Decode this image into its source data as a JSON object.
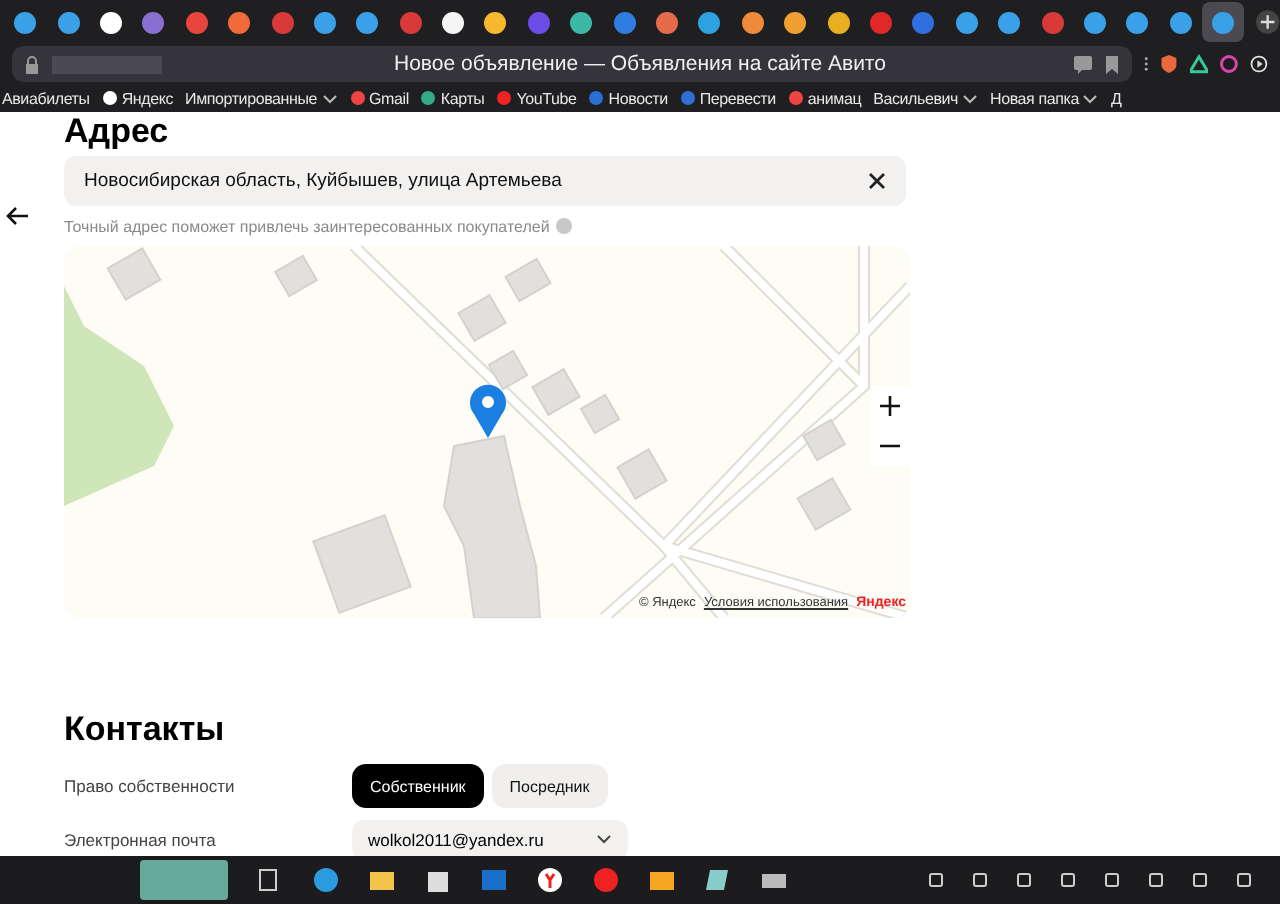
{
  "browser": {
    "tabs": [
      {
        "color": "#3aa0e8",
        "selected": false
      },
      {
        "color": "#3aa0e8",
        "selected": false
      },
      {
        "color": "#ffffff",
        "selected": false
      },
      {
        "color": "#8a6fd0",
        "selected": false
      },
      {
        "color": "#e8453c",
        "selected": false
      },
      {
        "color": "#f06a3a",
        "selected": false
      },
      {
        "color": "#d83a3a",
        "selected": false
      },
      {
        "color": "#3aa0e8",
        "selected": false
      },
      {
        "color": "#3aa0e8",
        "selected": false
      },
      {
        "color": "#d83a3a",
        "selected": false
      },
      {
        "color": "#f5f5f5",
        "selected": false
      },
      {
        "color": "#f5b82e",
        "selected": false
      },
      {
        "color": "#6b4de6",
        "selected": false
      },
      {
        "color": "#3bb8a6",
        "selected": false
      },
      {
        "color": "#2f7de1",
        "selected": false
      },
      {
        "color": "#e56b4a",
        "selected": false
      },
      {
        "color": "#2fa0e0",
        "selected": false
      },
      {
        "color": "#f08a3a",
        "selected": false
      },
      {
        "color": "#f0a030",
        "selected": false
      },
      {
        "color": "#e8b020",
        "selected": false
      },
      {
        "color": "#e02828",
        "selected": false
      },
      {
        "color": "#2f6fe0",
        "selected": false
      },
      {
        "color": "#3aa0e8",
        "selected": false
      },
      {
        "color": "#3aa0e8",
        "selected": false
      },
      {
        "color": "#d83a3a",
        "selected": false
      },
      {
        "color": "#3aa0e8",
        "selected": false
      },
      {
        "color": "#3aa0e8",
        "selected": false
      },
      {
        "color": "#3aa0e8",
        "selected": false
      },
      {
        "color": "#3aa0e8",
        "selected": true
      }
    ],
    "page_title": "Новое объявление — Объявления на сайте Авито",
    "bookmarks": [
      {
        "label": "Авиабилеты",
        "folder": false
      },
      {
        "label": "Яндекс",
        "folder": false
      },
      {
        "label": "Импортированные",
        "folder": true
      },
      {
        "label": "Gmail",
        "folder": false
      },
      {
        "label": "Карты",
        "folder": false
      },
      {
        "label": "YouTube",
        "folder": false
      },
      {
        "label": "Новости",
        "folder": false
      },
      {
        "label": "Перевести",
        "folder": false
      },
      {
        "label": "анимац",
        "folder": false
      },
      {
        "label": "Васильевич",
        "folder": true
      },
      {
        "label": "Новая папка",
        "folder": true
      },
      {
        "label": "Д",
        "folder": false
      }
    ]
  },
  "address": {
    "heading": "Адрес",
    "value": "Новосибирская область, Куйбышев, улица Артемьева",
    "hint": "Точный адрес поможет привлечь заинтересованных покупателей",
    "map": {
      "copyright": "© Яндекс",
      "terms_link": "Условия использования",
      "logo": "Яндекс"
    }
  },
  "contacts": {
    "heading": "Контакты",
    "ownership_label": "Право собственности",
    "ownership_options": [
      {
        "label": "Собственник",
        "selected": true
      },
      {
        "label": "Посредник",
        "selected": false
      }
    ],
    "email_label": "Электронная почта",
    "email_value": "wolkol2011@yandex.ru"
  }
}
